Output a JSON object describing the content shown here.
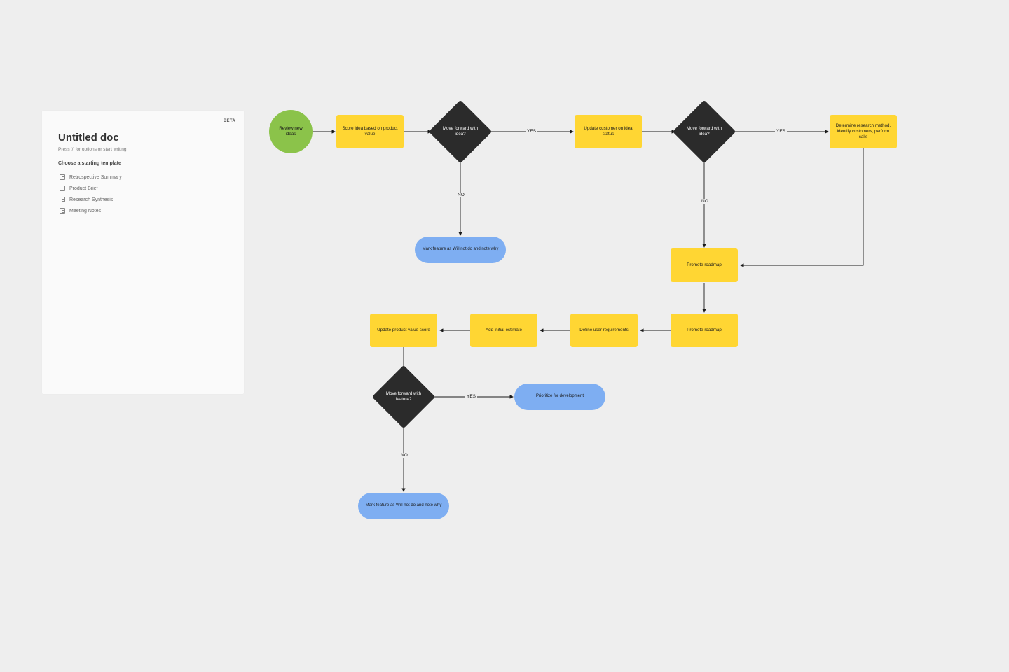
{
  "docPanel": {
    "badge": "BETA",
    "title": "Untitled doc",
    "subtitle": "Press '/' for options or start writing",
    "chooseLabel": "Choose a starting template",
    "templates": [
      {
        "label": "Retrospective Summary"
      },
      {
        "label": "Product Brief"
      },
      {
        "label": "Research Synthesis"
      },
      {
        "label": "Meeting Notes"
      }
    ]
  },
  "flow": {
    "nodes": {
      "start": "Review new ideas",
      "scoreIdea": "Score idea based on product value",
      "decision1": "Move forward with idea?",
      "updateCustomer": "Update customer on idea status",
      "decision2": "Move forward with idea?",
      "determineResearch": "Determine research method, identify customers, perform calls",
      "markWillNot1": "Mark feature as Will not do and note why",
      "promoteRoadmap1": "Promote roadmap",
      "promoteRoadmap2": "Promote roadmap",
      "defineUserReq": "Define user requirements",
      "addInitialEst": "Add initial estimate",
      "updateScore": "Update product value score",
      "decision3": "Move forward with feature?",
      "prioritizeDev": "Prioritize for development",
      "markWillNot2": "Mark feature as Will not do and note why"
    },
    "labels": {
      "yes": "YES",
      "no": "NO"
    }
  }
}
